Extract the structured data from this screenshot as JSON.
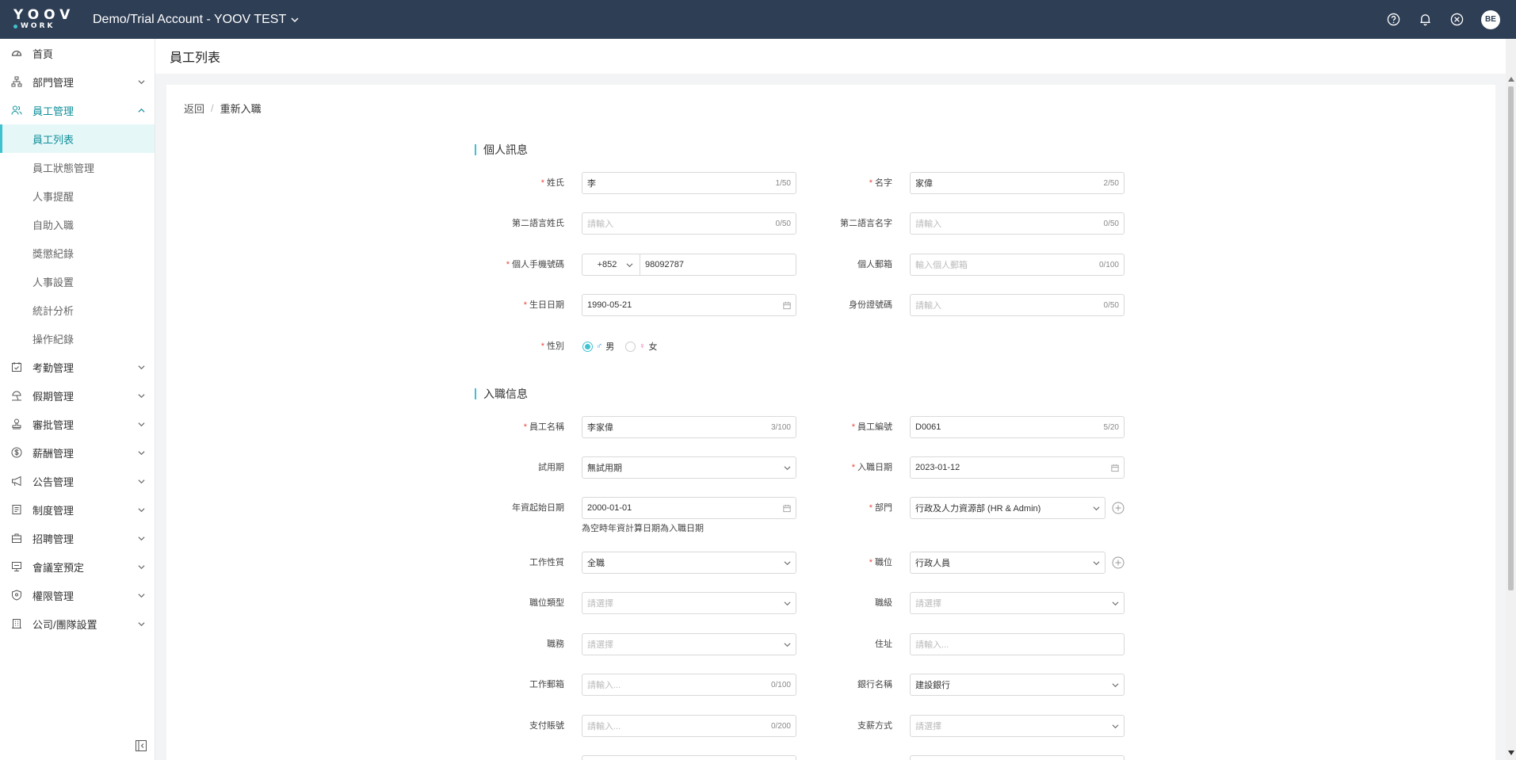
{
  "topbar": {
    "logo_top": "YOOV",
    "logo_bottom": "WORK",
    "account": "Demo/Trial Account - YOOV TEST",
    "avatar": "BE"
  },
  "sidebar": {
    "items": [
      {
        "label": "首頁",
        "icon": "dashboard-icon"
      },
      {
        "label": "部門管理",
        "icon": "org-chart-icon"
      },
      {
        "label": "員工管理",
        "icon": "users-icon"
      },
      {
        "label": "考勤管理",
        "icon": "calendar-check-icon"
      },
      {
        "label": "假期管理",
        "icon": "beach-icon"
      },
      {
        "label": "審批管理",
        "icon": "stamp-icon"
      },
      {
        "label": "薪酬管理",
        "icon": "dollar-icon"
      },
      {
        "label": "公告管理",
        "icon": "megaphone-icon"
      },
      {
        "label": "制度管理",
        "icon": "book-icon"
      },
      {
        "label": "招聘管理",
        "icon": "briefcase-icon"
      },
      {
        "label": "會議室預定",
        "icon": "presentation-icon"
      },
      {
        "label": "權限管理",
        "icon": "shield-icon"
      },
      {
        "label": "公司/團隊設置",
        "icon": "building-icon"
      }
    ],
    "sub_items": [
      "員工列表",
      "員工狀態管理",
      "人事提醒",
      "自助入職",
      "獎懲紀錄",
      "人事設置",
      "統計分析",
      "操作紀錄"
    ]
  },
  "page": {
    "title": "員工列表",
    "breadcrumb_back": "返回",
    "breadcrumb_sep": "/",
    "breadcrumb_current": "重新入職"
  },
  "personal": {
    "section_title": "個人訊息",
    "surname_label": "姓氏",
    "surname_value": "李",
    "surname_count": "1/50",
    "given_label": "名字",
    "given_value": "家偉",
    "given_count": "2/50",
    "second_surname_label": "第二語言姓氏",
    "second_surname_placeholder": "請輸入",
    "second_surname_count": "0/50",
    "second_given_label": "第二語言名字",
    "second_given_placeholder": "請輸入",
    "second_given_count": "0/50",
    "mobile_label": "個人手機號碼",
    "mobile_code": "+852",
    "mobile_value": "98092787",
    "email_label": "個人郵箱",
    "email_placeholder": "輸入個人郵箱",
    "email_count": "0/100",
    "birth_label": "生日日期",
    "birth_value": "1990-05-21",
    "id_label": "身份證號碼",
    "id_placeholder": "請輸入",
    "id_count": "0/50",
    "gender_label": "性別",
    "gender_male": "男",
    "gender_female": "女",
    "male_symbol": "♂",
    "female_symbol": "♀"
  },
  "onboard": {
    "section_title": "入職信息",
    "emp_name_label": "員工名稱",
    "emp_name_value": "李家偉",
    "emp_name_count": "3/100",
    "emp_no_label": "員工編號",
    "emp_no_value": "D0061",
    "emp_no_count": "5/20",
    "probation_label": "試用期",
    "probation_value": "無試用期",
    "join_date_label": "入職日期",
    "join_date_value": "2023-01-12",
    "annual_start_label": "年資起始日期",
    "annual_start_value": "2000-01-01",
    "annual_hint": "為空時年資計算日期為入職日期",
    "dept_label": "部門",
    "dept_value": "行政及人力資源部 (HR & Admin)",
    "work_nature_label": "工作性質",
    "work_nature_value": "全職",
    "position_label": "職位",
    "position_value": "行政人員",
    "position_type_label": "職位類型",
    "position_type_placeholder": "請選擇",
    "grade_label": "職級",
    "grade_placeholder": "請選擇",
    "duty_label": "職務",
    "duty_placeholder": "請選擇",
    "address_label": "住址",
    "address_placeholder": "請輸入...",
    "work_email_label": "工作郵箱",
    "work_email_placeholder": "請輸入...",
    "work_email_count": "0/100",
    "bank_label": "銀行名稱",
    "bank_value": "建設銀行",
    "pay_account_label": "支付賬號",
    "pay_account_placeholder": "請輸入...",
    "pay_account_count": "0/200",
    "pay_method_label": "支薪方式",
    "pay_method_placeholder": "請選擇"
  },
  "colors": {
    "topbar": "#2e3e55",
    "accent": "#3fc2d0",
    "required": "#e8473d"
  }
}
